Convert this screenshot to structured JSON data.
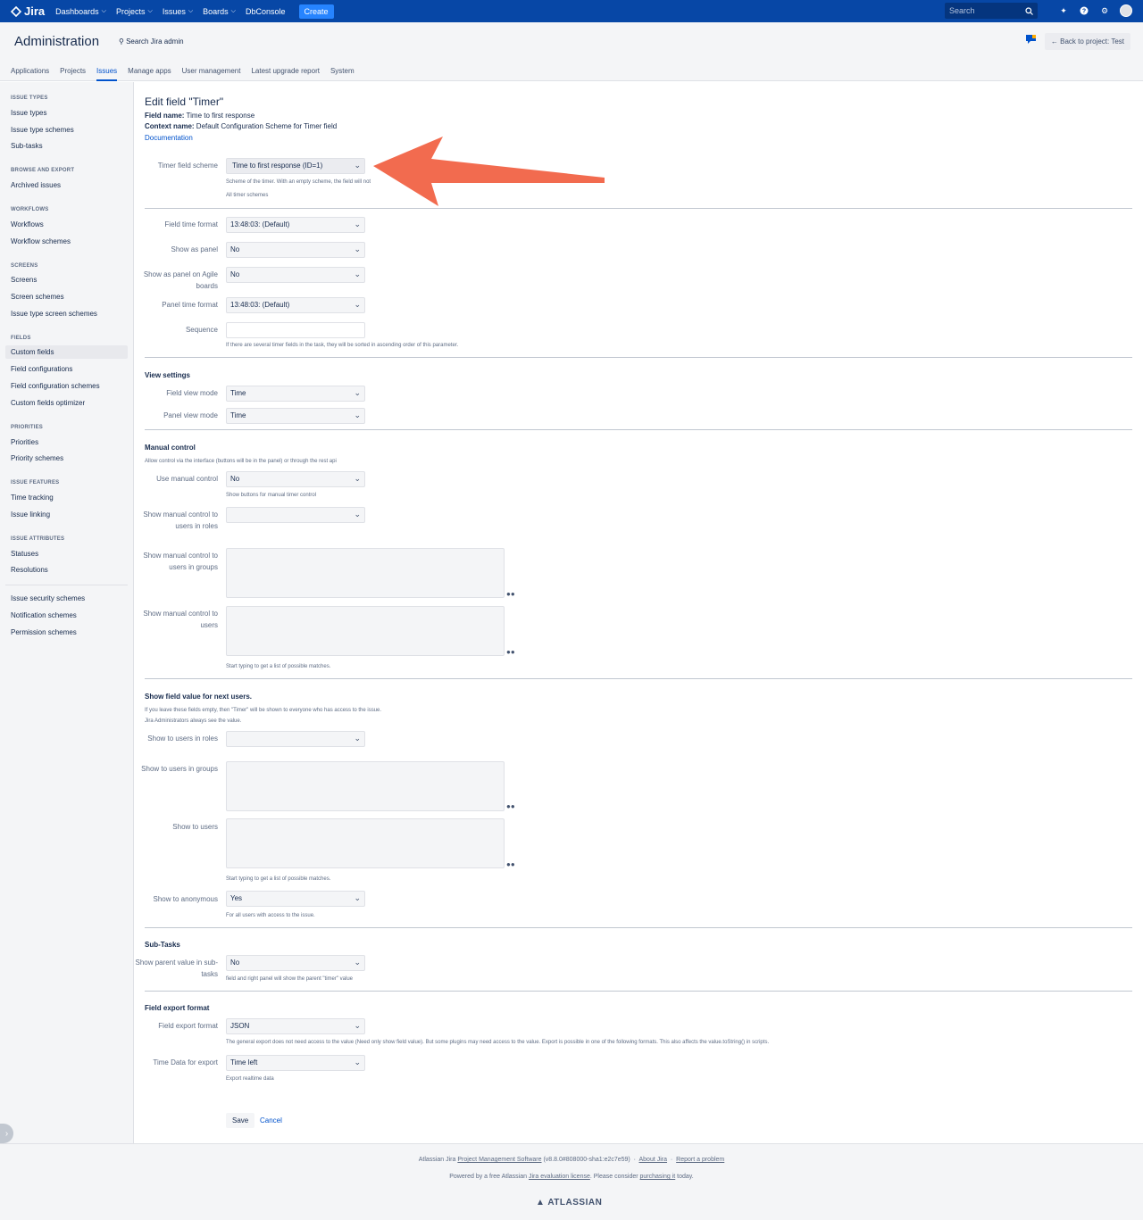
{
  "topnav": {
    "logo": "Jira",
    "items": [
      "Dashboards",
      "Projects",
      "Issues",
      "Boards",
      "DbConsole"
    ],
    "create": "Create",
    "search_placeholder": "Search"
  },
  "admin": {
    "title": "Administration",
    "search": "Search Jira admin",
    "back": "Back to project: Test",
    "tabs": [
      "Applications",
      "Projects",
      "Issues",
      "Manage apps",
      "User management",
      "Latest upgrade report",
      "System"
    ],
    "active_tab": "Issues"
  },
  "sidebar": {
    "sections": [
      {
        "heading": "ISSUE TYPES",
        "items": [
          "Issue types",
          "Issue type schemes",
          "Sub-tasks"
        ]
      },
      {
        "heading": "BROWSE AND EXPORT",
        "items": [
          "Archived issues"
        ]
      },
      {
        "heading": "WORKFLOWS",
        "items": [
          "Workflows",
          "Workflow schemes"
        ]
      },
      {
        "heading": "SCREENS",
        "items": [
          "Screens",
          "Screen schemes",
          "Issue type screen schemes"
        ]
      },
      {
        "heading": "FIELDS",
        "items": [
          "Custom fields",
          "Field configurations",
          "Field configuration schemes",
          "Custom fields optimizer"
        ]
      },
      {
        "heading": "PRIORITIES",
        "items": [
          "Priorities",
          "Priority schemes"
        ]
      },
      {
        "heading": "ISSUE FEATURES",
        "items": [
          "Time tracking",
          "Issue linking"
        ]
      },
      {
        "heading": "ISSUE ATTRIBUTES",
        "items": [
          "Statuses",
          "Resolutions"
        ]
      },
      {
        "heading": "",
        "items": [
          "Issue security schemes",
          "Notification schemes",
          "Permission schemes"
        ]
      }
    ],
    "active": "Custom fields"
  },
  "form": {
    "title": "Edit field \"Timer\"",
    "field_name_label": "Field name:",
    "field_name": "Time to first response",
    "context_label": "Context name:",
    "context": "Default Configuration Scheme for Timer field",
    "documentation": "Documentation",
    "scheme_label": "Timer field scheme",
    "scheme_value": "Time to first response (ID=1)",
    "scheme_hint": "Scheme of the timer. With an empty scheme, the field will not",
    "all_schemes": "All timer schemes",
    "field_time_format_label": "Field time format",
    "field_time_format": "13:48:03: (Default)",
    "show_panel_label": "Show as panel",
    "show_panel": "No",
    "show_agile_label": "Show as panel on Agile boards",
    "show_agile": "No",
    "panel_time_format_label": "Panel time format",
    "panel_time_format": "13:48:03: (Default)",
    "sequence_label": "Sequence",
    "sequence_hint": "If there are several timer fields in the task, they will be sorted in ascending order of this parameter.",
    "view_settings": "View settings",
    "field_view_mode_label": "Field view mode",
    "field_view_mode": "Time",
    "panel_view_mode_label": "Panel view mode",
    "panel_view_mode": "Time",
    "manual_control": "Manual control",
    "manual_hint": "Allow control via the interface (buttons will be in the panel) or through the rest api",
    "use_manual_label": "Use manual control",
    "use_manual": "No",
    "use_manual_hint": "Show buttons for manual timer control",
    "manual_roles_label": "Show manual control to users in roles",
    "manual_groups_label": "Show manual control to users in groups",
    "manual_users_label": "Show manual control to users",
    "typing_hint": "Start typing to get a list of possible matches.",
    "show_value": "Show field value for next users.",
    "show_value_hint1": "If you leave these fields empty, then \"Timer\" will be shown to everyone who has access to the issue.",
    "show_value_hint2": "Jira Administrators always see the value.",
    "roles_label": "Show to users in roles",
    "groups_label": "Show to users in groups",
    "users_label": "Show to users",
    "typing_hint2": "Start typing to get a list of possible matches.",
    "anonymous_label": "Show to anonymous",
    "anonymous": "Yes",
    "anonymous_hint": "For all users with access to the issue.",
    "subtasks": "Sub-Tasks",
    "parent_label": "Show parent value in sub-tasks",
    "parent": "No",
    "parent_hint": "field and right panel will show the parent \"timer\" value",
    "export_format": "Field export format",
    "export_label": "Field export format",
    "export": "JSON",
    "export_hint": "The general export does not need access to the value (Need only show field value). But some plugins may need access to the value. Export is possible in one of the following formats. This also affects the value.toString() in scripts.",
    "time_export_label": "Time Data for export",
    "time_export": "Time left",
    "time_export_hint": "Export realtime data",
    "save": "Save",
    "cancel": "Cancel"
  },
  "footer": {
    "line1_a": "Atlassian Jira",
    "line1_link1": "Project Management Software",
    "line1_ver": "(v8.8.0#808000-sha1:e2c7e59)",
    "line1_link2": "About Jira",
    "line1_link3": "Report a problem",
    "line2_a": "Powered by a free Atlassian",
    "line2_link1": "Jira evaluation license",
    "line2_b": ". Please consider",
    "line2_link2": "purchasing it",
    "line2_c": "today.",
    "brand": "ATLASSIAN"
  },
  "colors": {
    "nav": "#0747a6",
    "create": "#2684ff",
    "link": "#0052cc",
    "arrow": "#f26b4f"
  }
}
